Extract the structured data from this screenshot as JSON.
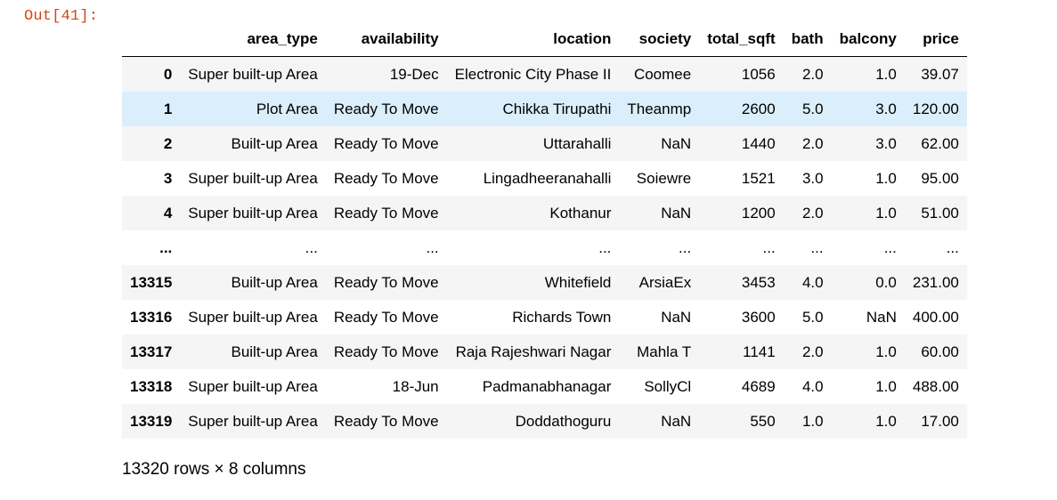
{
  "cell": {
    "prompt": "Out[41]:"
  },
  "table": {
    "columns": [
      "",
      "area_type",
      "availability",
      "location",
      "society",
      "total_sqft",
      "bath",
      "balcony",
      "price"
    ],
    "rows": [
      {
        "index": "0",
        "cells": [
          "Super built-up Area",
          "19-Dec",
          "Electronic City Phase II",
          "Coomee",
          "1056",
          "2.0",
          "1.0",
          "39.07"
        ]
      },
      {
        "index": "1",
        "cells": [
          "Plot Area",
          "Ready To Move",
          "Chikka Tirupathi",
          "Theanmp",
          "2600",
          "5.0",
          "3.0",
          "120.00"
        ]
      },
      {
        "index": "2",
        "cells": [
          "Built-up Area",
          "Ready To Move",
          "Uttarahalli",
          "NaN",
          "1440",
          "2.0",
          "3.0",
          "62.00"
        ]
      },
      {
        "index": "3",
        "cells": [
          "Super built-up Area",
          "Ready To Move",
          "Lingadheeranahalli",
          "Soiewre",
          "1521",
          "3.0",
          "1.0",
          "95.00"
        ]
      },
      {
        "index": "4",
        "cells": [
          "Super built-up Area",
          "Ready To Move",
          "Kothanur",
          "NaN",
          "1200",
          "2.0",
          "1.0",
          "51.00"
        ]
      },
      {
        "index": "...",
        "cells": [
          "...",
          "...",
          "...",
          "...",
          "...",
          "...",
          "...",
          "..."
        ]
      },
      {
        "index": "13315",
        "cells": [
          "Built-up Area",
          "Ready To Move",
          "Whitefield",
          "ArsiaEx",
          "3453",
          "4.0",
          "0.0",
          "231.00"
        ]
      },
      {
        "index": "13316",
        "cells": [
          "Super built-up Area",
          "Ready To Move",
          "Richards Town",
          "NaN",
          "3600",
          "5.0",
          "NaN",
          "400.00"
        ]
      },
      {
        "index": "13317",
        "cells": [
          "Built-up Area",
          "Ready To Move",
          "Raja Rajeshwari Nagar",
          "Mahla T",
          "1141",
          "2.0",
          "1.0",
          "60.00"
        ]
      },
      {
        "index": "13318",
        "cells": [
          "Super built-up Area",
          "18-Jun",
          "Padmanabhanagar",
          "SollyCl",
          "4689",
          "4.0",
          "1.0",
          "488.00"
        ]
      },
      {
        "index": "13319",
        "cells": [
          "Super built-up Area",
          "Ready To Move",
          "Doddathoguru",
          "NaN",
          "550",
          "1.0",
          "1.0",
          "17.00"
        ]
      }
    ],
    "hovered_row_index": "1"
  },
  "shape_text": "13320 rows × 8 columns",
  "colors": {
    "prompt": "#d84315",
    "row_stripe": "#f5f5f5",
    "row_hover": "#dbeefb"
  }
}
